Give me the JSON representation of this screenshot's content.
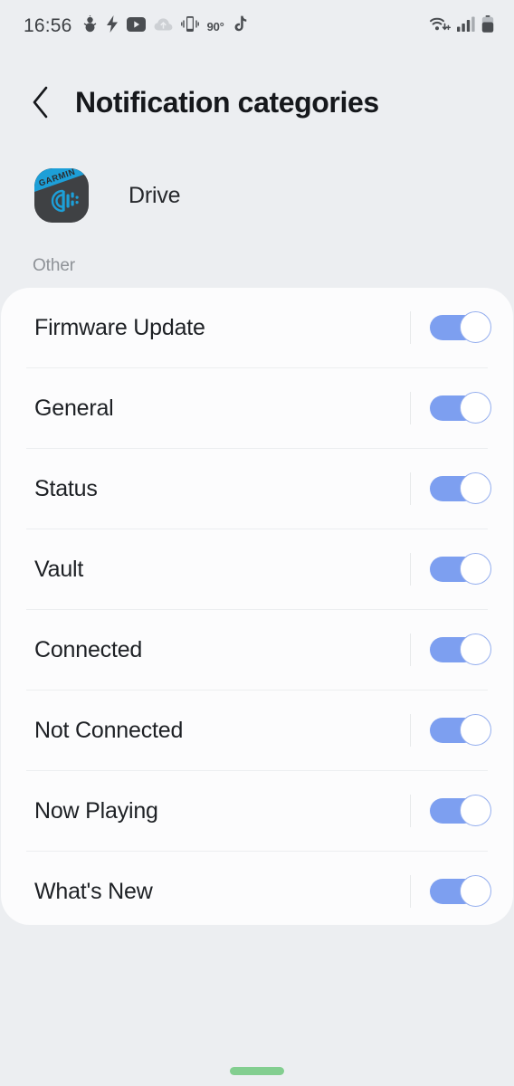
{
  "status_bar": {
    "clock": "16:56",
    "temperature": "90°",
    "left_icons": [
      "snowman-icon",
      "lightning-bolt-icon",
      "youtube-icon",
      "cloud-upload-icon",
      "phone-vibrate-icon",
      "tiktok-note-icon"
    ],
    "right_icons": [
      "wifi-download-icon",
      "signal-bars-icon",
      "battery-icon"
    ]
  },
  "header": {
    "back_label": "Back",
    "title": "Notification categories"
  },
  "app": {
    "name": "Drive",
    "icon_brand_text": "GARMIN",
    "icon_bg_color": "#3f4144",
    "icon_accent_color": "#1d9fd8"
  },
  "section": {
    "label": "Other"
  },
  "rows": [
    {
      "label": "Firmware Update",
      "toggle_on": true
    },
    {
      "label": "General",
      "toggle_on": true
    },
    {
      "label": "Status",
      "toggle_on": true
    },
    {
      "label": "Vault",
      "toggle_on": true
    },
    {
      "label": "Connected",
      "toggle_on": true
    },
    {
      "label": "Not Connected",
      "toggle_on": true
    },
    {
      "label": "Now Playing",
      "toggle_on": true
    },
    {
      "label": "What's New",
      "toggle_on": true
    }
  ],
  "theme": {
    "background": "#eceef1",
    "card_background": "#fcfcfd",
    "toggle_on_color": "#7d9ff0",
    "gesture_bar_color": "#83ce90"
  }
}
